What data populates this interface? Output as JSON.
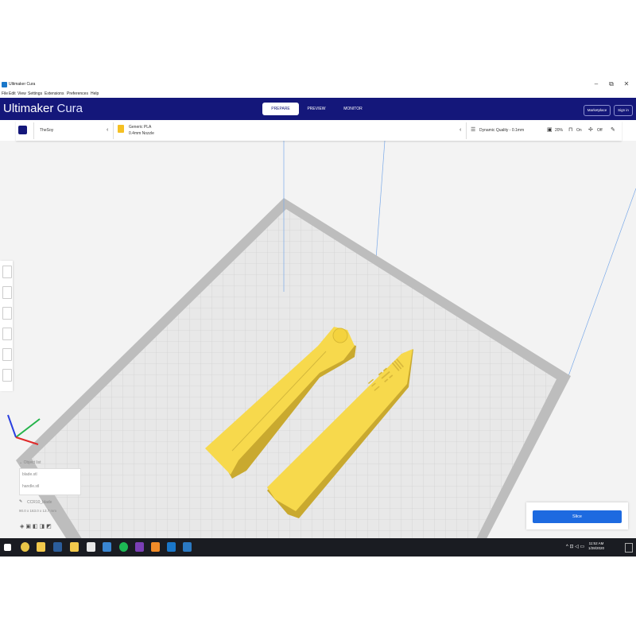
{
  "window": {
    "title": "Ultimaker Cura",
    "minimize": "–",
    "restore": "⧉",
    "close": "✕"
  },
  "menu": [
    "File",
    "Edit",
    "View",
    "Settings",
    "Extensions",
    "Preferences",
    "Help"
  ],
  "header": {
    "brand_bold": "Ultimaker",
    "brand_thin": " Cura",
    "tabs": [
      "PREPARE",
      "PREVIEW",
      "MONITOR"
    ],
    "active_tab": "PREPARE",
    "marketplace": "Marketplace",
    "signin": "Sign in"
  },
  "toolbar": {
    "printer": "TheSoy",
    "material_name": "Generic PLA",
    "nozzle": "0.4mm Nozzle",
    "profile": "Dynamic Quality - 0.1mm",
    "infill": "20%",
    "support": "On",
    "adhesion": "Off"
  },
  "objects": {
    "header": "Object list",
    "items": [
      "blade.stl",
      "handle.stl"
    ],
    "current_file": "CCR10_blade",
    "dimensions": "90.0 x 163.0 x 13.7 mm"
  },
  "slice": {
    "button": "Slice"
  },
  "taskbar": {
    "time": "11:52 AM",
    "date": "1/28/2020"
  },
  "colors": {
    "header_bg": "#14177a",
    "accent": "#1d6ae0",
    "model": "#f7d94c",
    "build_plate": "#e8e8e8"
  }
}
